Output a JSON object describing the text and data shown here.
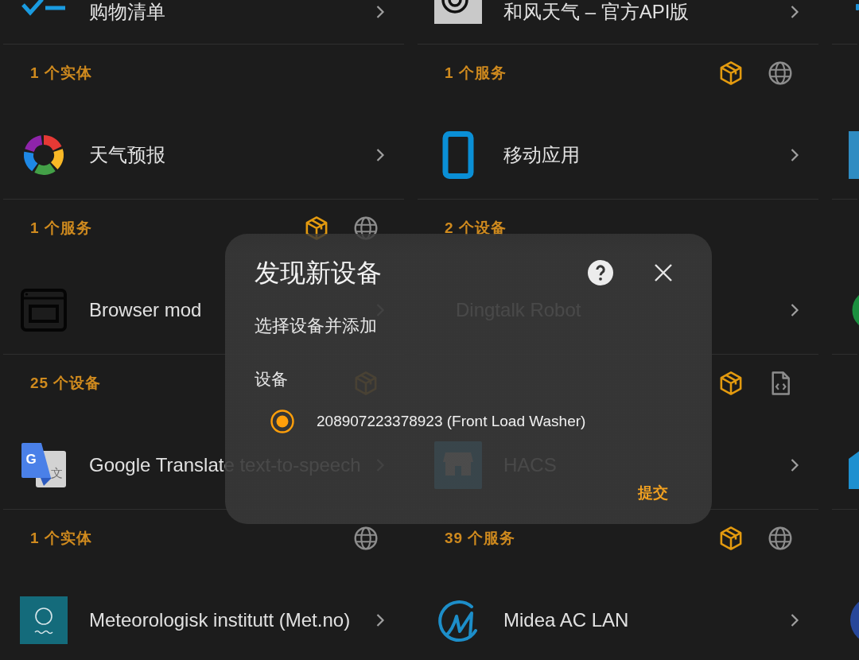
{
  "columns": [
    {
      "cards": [
        {
          "kind": "checklist",
          "name": "购物清单",
          "count": "1 个实体"
        },
        {
          "kind": "pinwheel",
          "name": "天气预报",
          "count": "1 个服务",
          "badges": [
            {
              "kind": "custom"
            },
            {
              "kind": "cloud"
            }
          ]
        },
        {
          "kind": "browser",
          "name": "Browser mod",
          "count": "25 个设备",
          "badges": [
            {
              "kind": "custom"
            }
          ]
        },
        {
          "kind": "translate",
          "logo_letters": [
            "G",
            "文"
          ],
          "name": "Google Translate text-to-speech",
          "count": "1 个实体",
          "badges": [
            {
              "kind": "cloud"
            }
          ]
        },
        {
          "kind": "meteo",
          "name": "Meteorologisk institutt (Met.no)"
        }
      ]
    },
    {
      "cards": [
        {
          "kind": "swirl",
          "name": "和风天气 – 官方API版",
          "count": "1 个服务",
          "badges": [
            {
              "kind": "custom"
            },
            {
              "kind": "cloud"
            }
          ]
        },
        {
          "kind": "phone",
          "name": "移动应用",
          "count": "2 个设备"
        },
        {
          "name": "Dingtalk Robot",
          "badges": [
            {
              "kind": "custom"
            },
            {
              "kind": "yaml"
            }
          ]
        },
        {
          "kind": "hacs",
          "name": "HACS",
          "count": "39 个服务",
          "badges": [
            {
              "kind": "custom"
            },
            {
              "kind": "cloud"
            }
          ]
        },
        {
          "kind": "midea",
          "name": "Midea AC LAN"
        }
      ]
    },
    {
      "cards": [
        {
          "kind": "bar"
        },
        {
          "kind": "tile"
        },
        {
          "kind": "ring"
        },
        {
          "kind": "house"
        },
        {
          "kind": "sphere"
        }
      ]
    }
  ],
  "dialog": {
    "title": "发现新设备",
    "description": "选择设备并添加",
    "field_label": "设备",
    "options": [
      {
        "label": "208907223378923 (Front Load Washer)",
        "selected": true
      }
    ],
    "submit": "提交"
  }
}
